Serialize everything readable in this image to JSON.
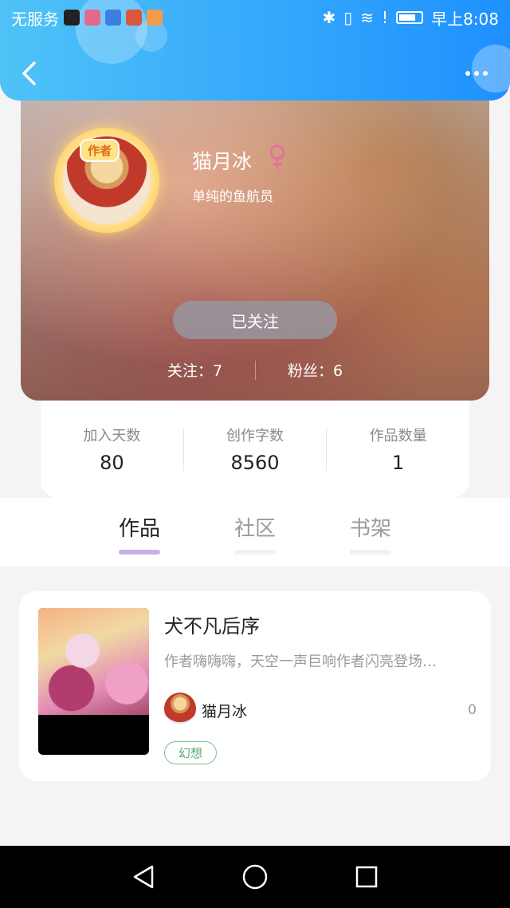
{
  "status_bar": {
    "carrier": "无服务",
    "time": "早上8:08"
  },
  "profile": {
    "author_badge": "作者",
    "username": "猫月冰",
    "gender": "female",
    "bio": "单纯的鱼航员",
    "follow_button": "已关注",
    "following": "关注：7",
    "fans": "粉丝：6"
  },
  "stats": [
    {
      "label": "加入天数",
      "value": "80"
    },
    {
      "label": "创作字数",
      "value": "8560"
    },
    {
      "label": "作品数量",
      "value": "1"
    }
  ],
  "tabs": [
    {
      "label": "作品",
      "active": true
    },
    {
      "label": "社区",
      "active": false
    },
    {
      "label": "书架",
      "active": false
    }
  ],
  "works": [
    {
      "title": "犬不凡后序",
      "description": "作者嗨嗨嗨，天空一声巨响作者闪亮登场…",
      "author": "猫月冰",
      "count": "0",
      "tag": "幻想"
    }
  ],
  "colors": {
    "header_start": "#4fc3f7",
    "header_end": "#1e90ff",
    "tab_underline": "#c9b0e8",
    "tag_green": "#7cc28a",
    "gender_pink": "#e4739b"
  }
}
